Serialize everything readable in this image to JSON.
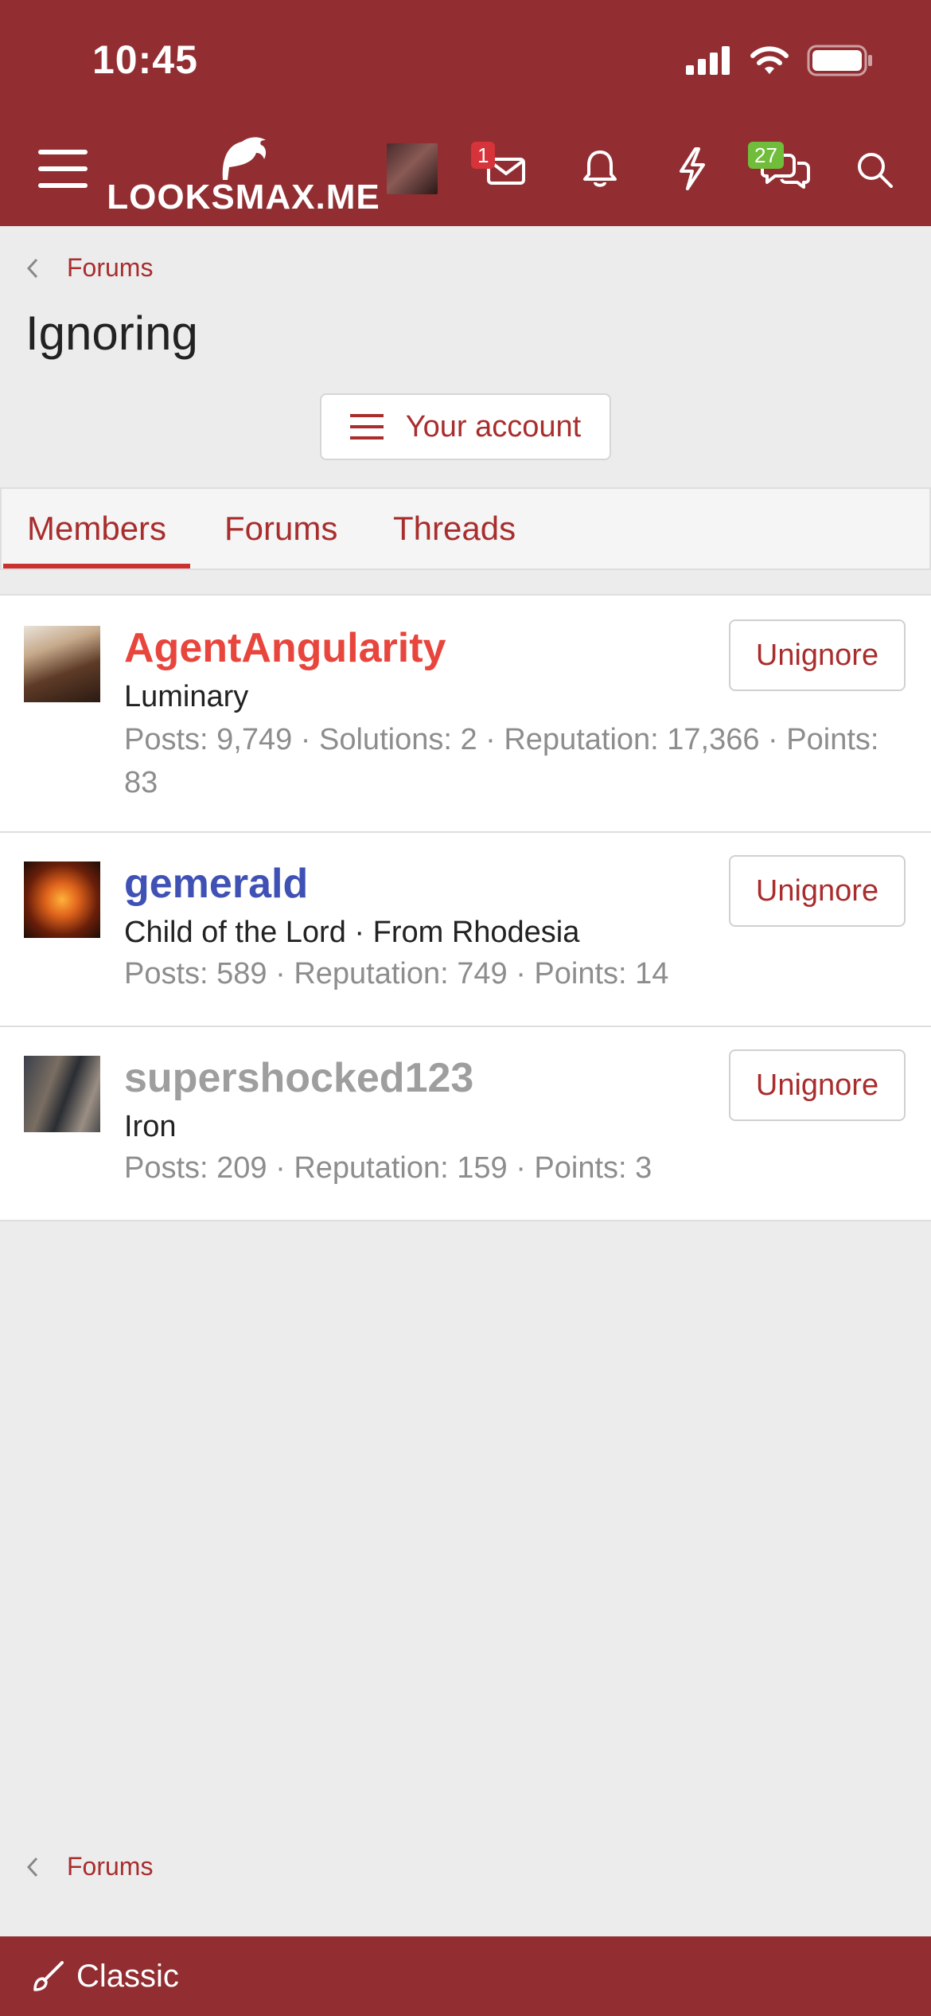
{
  "status_bar": {
    "time": "10:45"
  },
  "header": {
    "logo_text": "LOOKSMAX.ME",
    "inbox_badge": "1",
    "chat_badge": "27",
    "colors": {
      "brand": "#922e32",
      "badge_red": "#d6333a",
      "badge_green": "#6fbd3a"
    },
    "icons": [
      "menu-icon",
      "inbox-icon",
      "bell-icon",
      "lightning-icon",
      "chat-icon",
      "search-icon"
    ]
  },
  "breadcrumb": {
    "label": "Forums"
  },
  "page": {
    "title": "Ignoring",
    "account_button": "Your account"
  },
  "tabs": [
    {
      "label": "Members",
      "active": true
    },
    {
      "label": "Forums",
      "active": false
    },
    {
      "label": "Threads",
      "active": false
    }
  ],
  "members": [
    {
      "name": "AgentAngularity",
      "name_color": "#e8453c",
      "title": "Luminary",
      "stats": "Posts: 9,749 · Solutions: 2 · Reputation: 17,366 · Points: 83",
      "button": "Unignore"
    },
    {
      "name": "gemerald",
      "name_color": "#3f51b5",
      "title": "Child of the Lord · From Rhodesia",
      "stats": "Posts: 589 · Reputation: 749 · Points: 14",
      "button": "Unignore"
    },
    {
      "name": "supershocked123",
      "name_color": "#9e9e9e",
      "title": "Iron",
      "stats": "Posts: 209 · Reputation: 159 · Points: 3",
      "button": "Unignore"
    }
  ],
  "footer": {
    "breadcrumb": "Forums",
    "style_label": "Classic"
  }
}
